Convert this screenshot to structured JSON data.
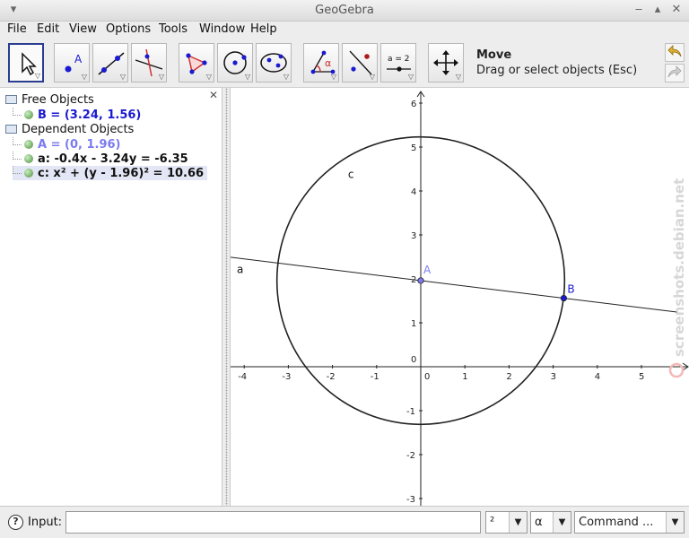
{
  "window": {
    "title": "GeoGebra",
    "buttons": [
      "▾",
      "‒",
      "▴",
      "✕"
    ]
  },
  "menu": [
    "File",
    "Edit",
    "View",
    "Options",
    "Tools",
    "Window",
    "Help"
  ],
  "toolbar": {
    "tools": [
      "move-tool",
      "point-tool",
      "line-tool",
      "perpendicular-tool",
      "polygon-tool",
      "circle-tool",
      "conic-tool",
      "angle-tool",
      "reflect-tool",
      "slider-tool",
      "move-graphics-tool"
    ],
    "slider_label": "a = 2",
    "point_label": "A",
    "angle_label": "α",
    "selected_tool_name": "Move",
    "selected_tool_desc": "Drag or select objects (Esc)"
  },
  "algebra": {
    "close": "✕",
    "free_group": "Free Objects",
    "free_items": [
      "B = (3.24, 1.56)"
    ],
    "dependent_group": "Dependent Objects",
    "dependent_items": [
      "A = (0, 1.96)",
      "a: -0.4x - 3.24y = -6.35",
      "c: x² + (y - 1.96)² = 10.66"
    ]
  },
  "graphics": {
    "x_ticks": [
      -4,
      -3,
      -2,
      -1,
      0,
      1,
      2,
      3,
      4,
      5
    ],
    "y_ticks": [
      -3,
      -2,
      -1,
      0,
      1,
      2,
      3,
      4,
      5,
      6
    ],
    "labels": {
      "a": "a",
      "c": "c",
      "A": "A",
      "B": "B"
    },
    "points": {
      "A": [
        0,
        1.96
      ],
      "B": [
        3.24,
        1.56
      ]
    },
    "circle": {
      "center": [
        0,
        1.96
      ],
      "radius": 3.265
    },
    "line": {
      "p1": [
        0,
        1.96
      ],
      "p2": [
        3.24,
        1.56
      ]
    },
    "colors": {
      "point_A": "#7b7bf0",
      "point_B": "#1a1ad0",
      "curve": "#222222"
    },
    "watermark": "screenshots.debian.net"
  },
  "inputbar": {
    "label": "Input:",
    "value": "",
    "superscript_combo": "²",
    "greek_combo": "α",
    "command_combo": "Command ...",
    "dropdown_arrow": "▼"
  }
}
